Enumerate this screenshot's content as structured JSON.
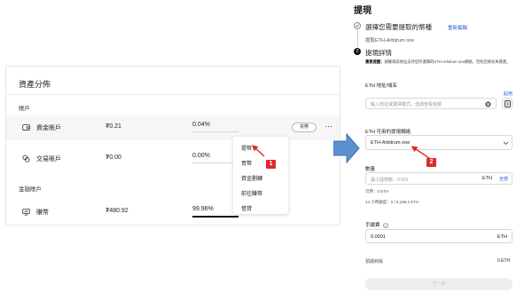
{
  "asset_panel": {
    "title": "資產分佈",
    "accounts_section": "賬戶",
    "margin_section": "金融賬戶",
    "rows": [
      {
        "name": "資金賬戶",
        "balance": "₮0.21",
        "percent": "0.04%",
        "percent_value": 0.04,
        "icon": "wallet-icon"
      },
      {
        "name": "交易賬戶",
        "balance": "₮0.00",
        "percent": "0.00%",
        "percent_value": 0.0,
        "icon": "exchange-icon"
      },
      {
        "name": "賺幣",
        "balance": "₮480.92",
        "percent": "99.96%",
        "percent_value": 99.96,
        "icon": "earn-icon"
      }
    ],
    "transfer_label": "充幣",
    "more_label": "···"
  },
  "menu": {
    "items": [
      "提幣",
      "買幣",
      "資金劃轉",
      "前往賺幣",
      "借貸"
    ]
  },
  "badges": {
    "first": "1",
    "second": "2"
  },
  "withdraw": {
    "title": "提現",
    "step1_label": "選擇您需要提取的幣種",
    "reselect_link": "重新編輯",
    "step1_sub": "提取ETH-Arbitrum one",
    "step1_number": "1",
    "step2_number": "2",
    "step2_label": "提現詳情",
    "notice_bold": "重要提醒：",
    "notice_text": "請確保該地址支持您所選擇的ETH-Arbitrum one網絡，否則您將丟失資產。",
    "address_label": "ETH 地址/域名",
    "address_placeholder": "輸入地址或選擇模式，但請查看金額",
    "address_link": "貼用",
    "network_label": "ETH 可用的提現網絡",
    "network_value": "ETH-Arbitrum one",
    "amount_label": "數量",
    "amount_placeholder": "最小提幣數：0.001",
    "amount_unit": "ETH",
    "amount_all": "全部",
    "available": "可用：0 ETH",
    "limit": "24 小時額度：0 / 5,198.2 ETH",
    "fee_label": "手續費",
    "fee_value": "0.0001",
    "fee_unit": "ETH",
    "receive_label": "預期到賬",
    "receive_value": "0 ETH",
    "next_button": "下一步"
  },
  "colors": {
    "badge_red": "#e0292c",
    "arrow_blue": "#5b8fd0",
    "link_blue": "#2a5bd7"
  }
}
